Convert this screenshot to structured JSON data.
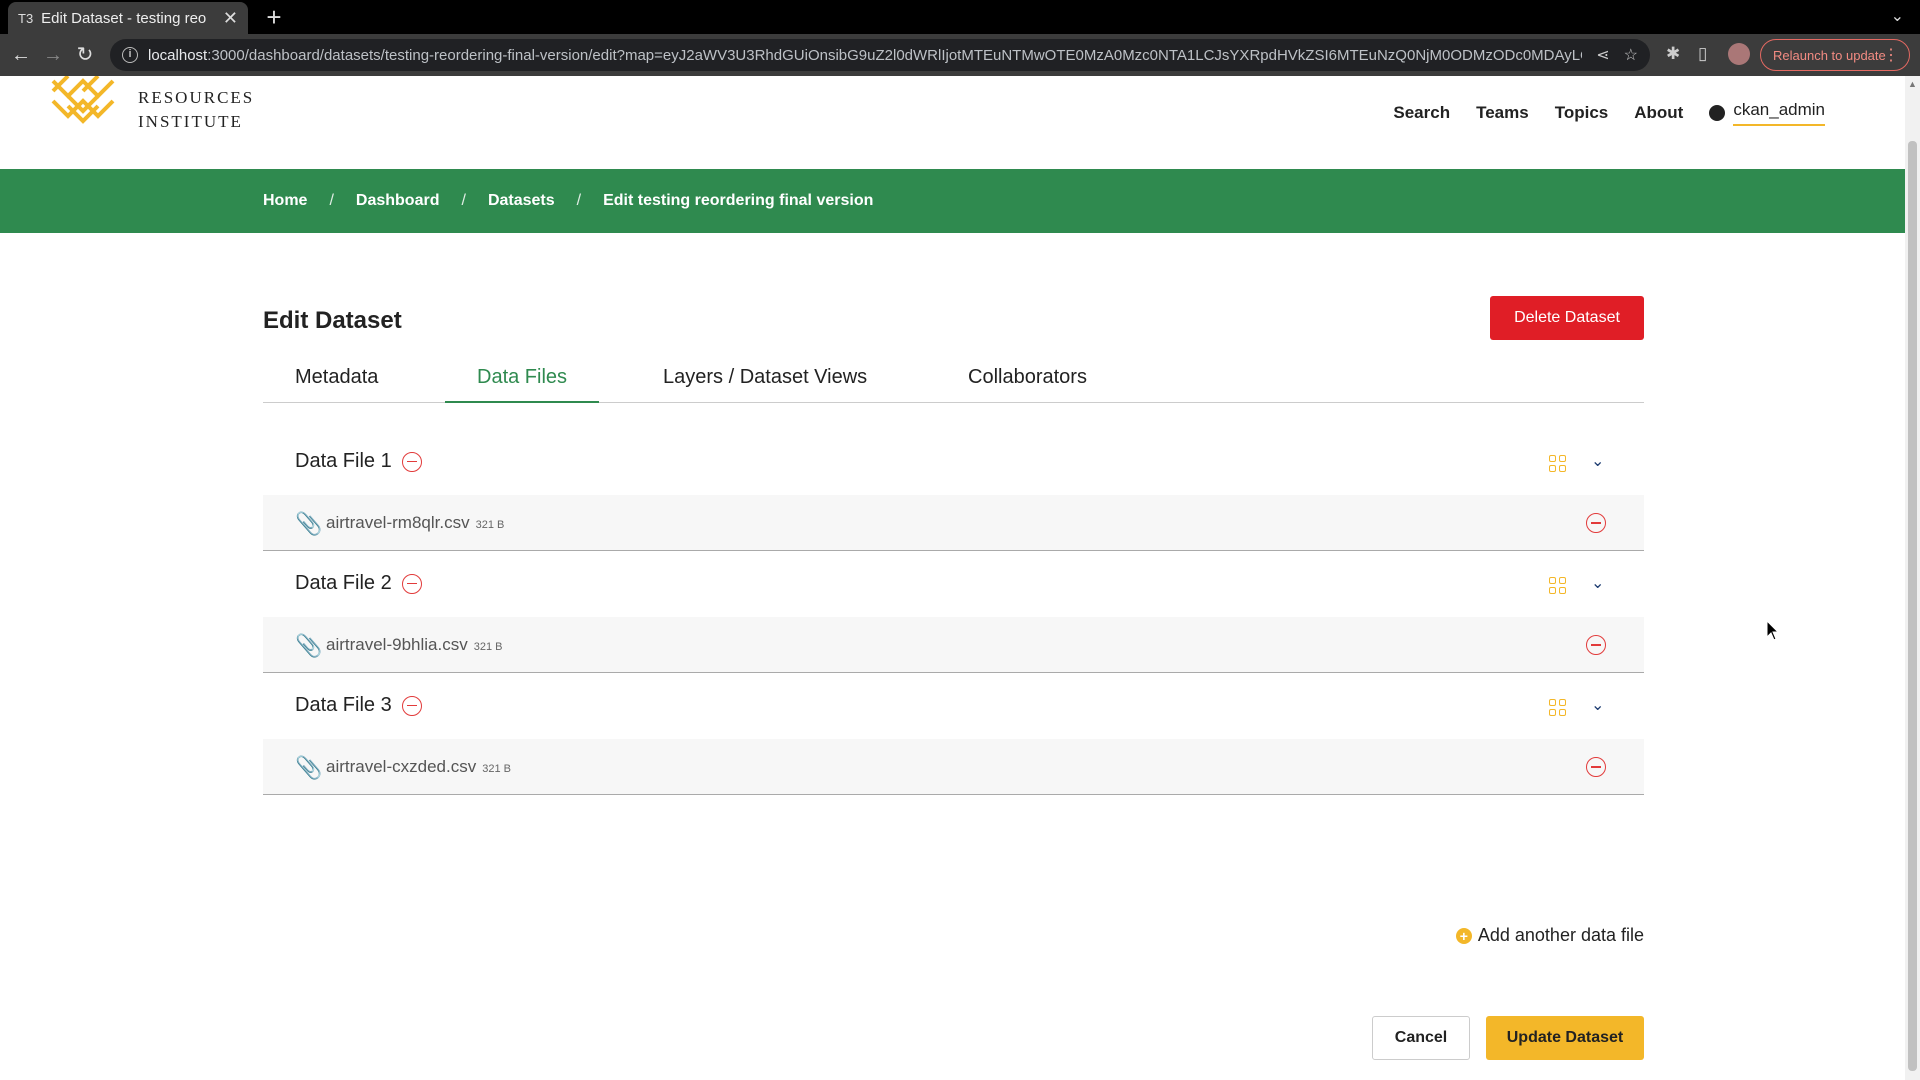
{
  "browser": {
    "tab_title": "Edit Dataset - testing reo",
    "tab_favicon": "T3",
    "url_host": "localhost",
    "url_rest": ":3000/dashboard/datasets/testing-reordering-final-version/edit?map=eyJ2aWV3U3RhdGUiOnsibG9uZ2l0dWRlIjotMTEuNTMwOTE0MzA0Mzc0NTA1LCJsYXRpdHVkZSI6MTEuNzQ0NjM0ODMzODc0MDAyLCJ6b29tIjo2LjM...",
    "relaunch_label": "Relaunch to update"
  },
  "site": {
    "logo_line1": "RESOURCES",
    "logo_line2": "INSTITUTE",
    "nav": [
      "Search",
      "Teams",
      "Topics",
      "About"
    ],
    "username": "ckan_admin"
  },
  "breadcrumb": [
    "Home",
    "Dashboard",
    "Datasets",
    "Edit testing reordering final version"
  ],
  "page": {
    "title": "Edit Dataset",
    "delete_label": "Delete Dataset",
    "tabs": [
      "Metadata",
      "Data Files",
      "Layers / Dataset Views",
      "Collaborators"
    ],
    "active_tab": "Data Files"
  },
  "files": [
    {
      "title": "Data File 1",
      "name": "airtravel-rm8qlr.csv",
      "size": "321 B"
    },
    {
      "title": "Data File 2",
      "name": "airtravel-9bhlia.csv",
      "size": "321 B"
    },
    {
      "title": "Data File 3",
      "name": "airtravel-cxzded.csv",
      "size": "321 B"
    }
  ],
  "actions": {
    "add_file": "Add another data file",
    "cancel": "Cancel",
    "update": "Update Dataset"
  },
  "colors": {
    "brand_green": "#2f8a4f",
    "accent_yellow": "#f3b729",
    "danger_red": "#e01e26"
  }
}
